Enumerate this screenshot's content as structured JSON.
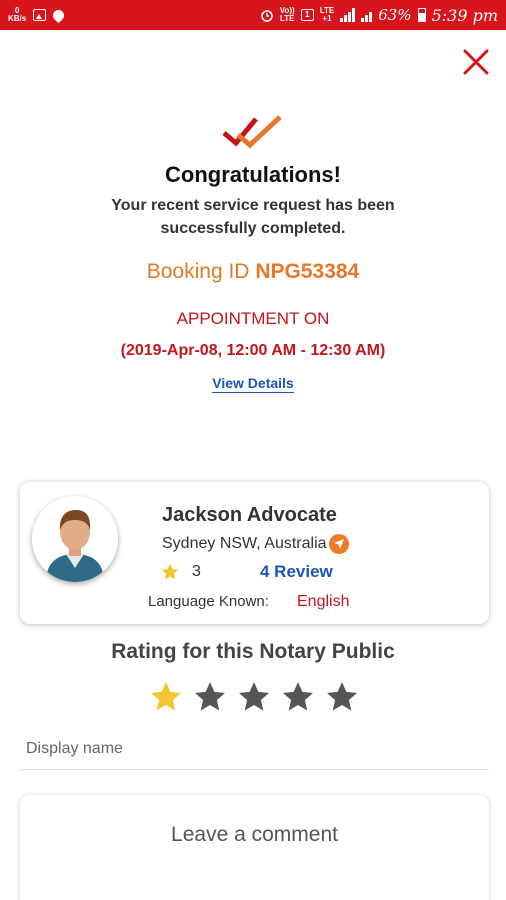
{
  "status_bar": {
    "speed_top": "0",
    "speed_bottom": "KB/s",
    "volte_top": "Vo))",
    "volte_bottom": "LTE",
    "sim": "1",
    "lte_top": "LTE",
    "lte_bottom": "+1",
    "battery_pct": "63%",
    "time": "5:39 pm"
  },
  "success": {
    "title": "Congratulations!",
    "message": "Your recent service request has been successfully completed.",
    "booking_prefix": "Booking ID",
    "booking_id": "NPG53384",
    "appointment_label": "APPOINTMENT ON",
    "appointment_time": "(2019-Apr-08, 12:00 AM - 12:30 AM)",
    "view_details": "View Details"
  },
  "profile": {
    "name": "Jackson Advocate",
    "location": "Sydney NSW, Australia",
    "rating": "3",
    "reviews": "4 Review",
    "language_label": "Language Known:",
    "language": "English"
  },
  "rating_section": {
    "title": "Rating for this Notary Public",
    "selected_stars": 1,
    "max_stars": 5
  },
  "form": {
    "display_name_placeholder": "Display name",
    "comment_placeholder": "Leave a comment"
  },
  "colors": {
    "status_bar": "#d8141c",
    "accent_red": "#c3161c",
    "accent_orange": "#e8772a",
    "link_blue": "#1a56b8",
    "star_filled": "#f2c531",
    "star_empty": "#555555"
  },
  "icons": {
    "close": "close-icon",
    "success": "double-check-icon",
    "location": "navigation-arrow-icon",
    "rating": "star-icon"
  }
}
